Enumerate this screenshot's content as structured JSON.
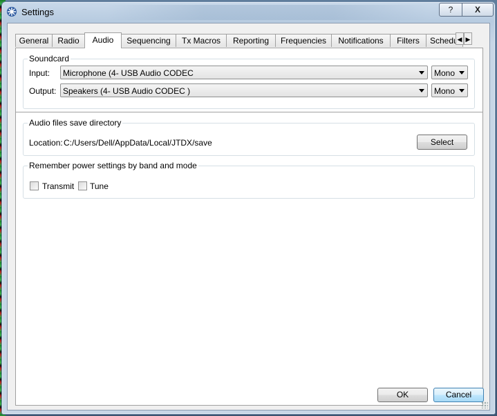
{
  "window": {
    "title": "Settings",
    "help_label": "?",
    "close_label": "X",
    "icon": "settings-gear-icon"
  },
  "tabs": [
    {
      "label": "General"
    },
    {
      "label": "Radio"
    },
    {
      "label": "Audio"
    },
    {
      "label": "Sequencing"
    },
    {
      "label": "Tx Macros"
    },
    {
      "label": "Reporting"
    },
    {
      "label": "Frequencies"
    },
    {
      "label": "Notifications"
    },
    {
      "label": "Filters"
    },
    {
      "label": "Schedu"
    }
  ],
  "active_tab": "Audio",
  "tab_scroll": {
    "left_icon": "chevron-left-icon",
    "right_icon": "chevron-right-icon"
  },
  "soundcard": {
    "title": "Soundcard",
    "input_label": "Input:",
    "input_value": "Microphone (4- USB Audio CODEC",
    "input_channel": "Mono",
    "output_label": "Output:",
    "output_value": "Speakers (4- USB Audio CODEC )",
    "output_channel": "Mono"
  },
  "save_dir": {
    "title": "Audio files save directory",
    "location_label": "Location:",
    "location_value": "C:/Users/Dell/AppData/Local/JTDX/save",
    "select_label": "Select"
  },
  "power": {
    "title": "Remember power settings by band and mode",
    "transmit_label": "Transmit",
    "tune_label": "Tune",
    "transmit_checked": false,
    "tune_checked": false
  },
  "footer": {
    "ok_label": "OK",
    "cancel_label": "Cancel"
  }
}
